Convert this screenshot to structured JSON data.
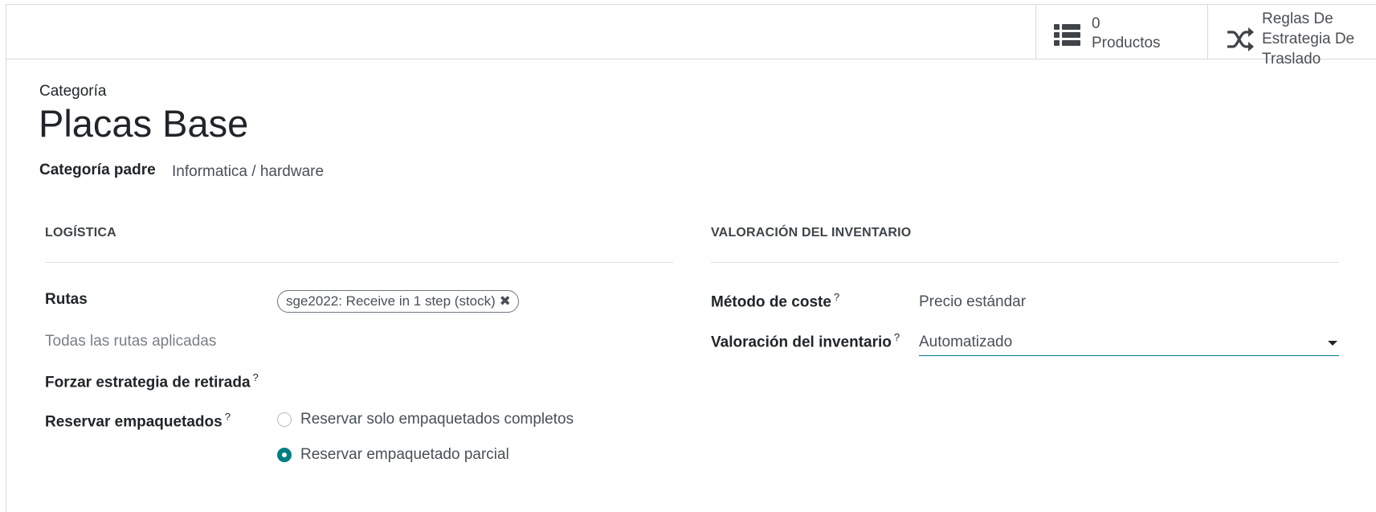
{
  "smart_buttons": {
    "products": {
      "icon": "list-icon",
      "count": "0",
      "label": "Productos"
    },
    "rules": {
      "icon": "shuffle-icon",
      "label": "Reglas De Estrategia De Traslado"
    }
  },
  "header": {
    "record_label": "Categoría",
    "record_title": "Placas Base",
    "parent_label": "Categoría padre",
    "parent_value": "Informatica / hardware"
  },
  "logistics": {
    "section_title": "LOGÍSTICA",
    "routes_label": "Rutas",
    "route_tag": "sge2022: Receive in 1 step (stock)",
    "all_routes_label": "Todas las rutas aplicadas",
    "removal_label": "Forzar estrategia de retirada",
    "reserve_label": "Reservar empaquetados",
    "reserve_options": [
      {
        "label": "Reservar solo empaquetados completos",
        "checked": false
      },
      {
        "label": "Reservar empaquetado parcial",
        "checked": true
      }
    ]
  },
  "valuation": {
    "section_title": "VALORACIÓN DEL INVENTARIO",
    "cost_method_label": "Método de coste",
    "cost_method_value": "Precio estándar",
    "inventory_valuation_label": "Valoración del inventario",
    "inventory_valuation_value": "Automatizado"
  },
  "help_marker": "?",
  "colors": {
    "accent": "#017e84",
    "border": "#d8dadd",
    "text": "#212529",
    "muted": "#495057"
  }
}
